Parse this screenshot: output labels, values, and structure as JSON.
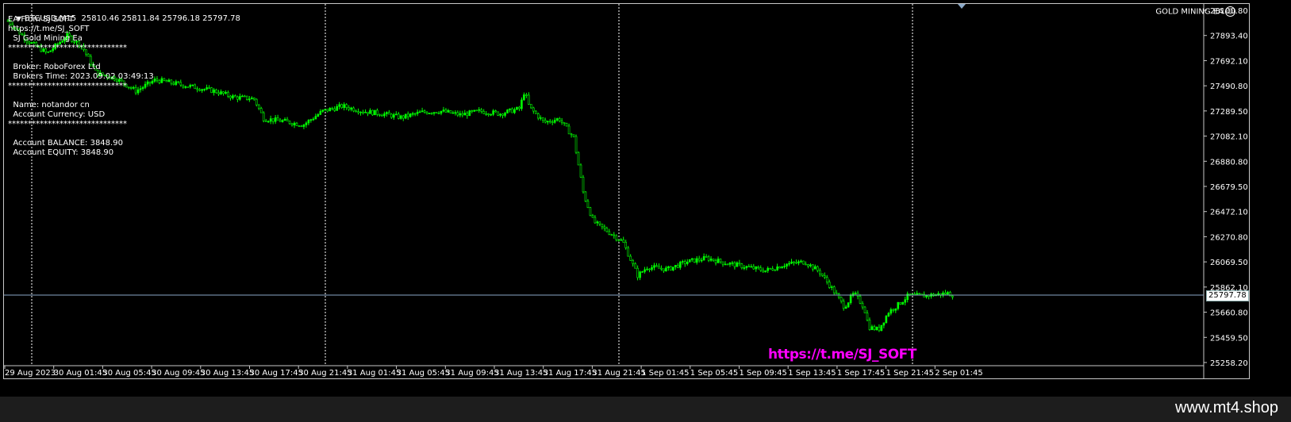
{
  "header": {
    "symbol": "BTCUSD,M15",
    "ohlc": "25810.46 25811.84 25796.18 25797.78"
  },
  "ea_label": "GOLD MINING EA",
  "info_lines": [
    "EA From SJ SOFT",
    "https://t.me/SJ_SOFT",
    "  SJ Gold Mining Ea",
    "******************************",
    "",
    "  Broker: RoboForex Ltd",
    "  Brokers Time: 2023.09.02 03:49:13",
    "******************************",
    "",
    "  Name: notandor cn",
    "  Account Currency: USD",
    "******************************",
    "",
    "  Account BALANCE: 3848.90",
    "  Account EQUITY: 3848.90"
  ],
  "watermark_link": "https://t.me/SJ_SOFT",
  "current_price": "25797.78",
  "footer_text": "www.mt4.shop",
  "colors": {
    "background": "#000000",
    "candle": "#00ff00",
    "grid_vertical": "#ffffff",
    "price_line": "#8aa8c8",
    "link": "#ff00ff"
  },
  "chart_data": {
    "type": "candlestick",
    "price_axis_ticks": [
      "28100.80",
      "27893.40",
      "27692.10",
      "27490.80",
      "27289.50",
      "27082.10",
      "26880.80",
      "26679.50",
      "26472.10",
      "26270.80",
      "26069.50",
      "25862.10",
      "25660.80",
      "25459.50",
      "25258.20"
    ],
    "time_axis_ticks": [
      "29 Aug 2023",
      "30 Aug 01:45",
      "30 Aug 05:45",
      "30 Aug 09:45",
      "30 Aug 13:45",
      "30 Aug 17:45",
      "30 Aug 21:45",
      "31 Aug 01:45",
      "31 Aug 05:45",
      "31 Aug 09:45",
      "31 Aug 13:45",
      "31 Aug 17:45",
      "31 Aug 21:45",
      "1 Sep 01:45",
      "1 Sep 05:45",
      "1 Sep 09:45",
      "1 Sep 13:45",
      "1 Sep 17:45",
      "1 Sep 21:45",
      "2 Sep 01:45"
    ],
    "ylim": [
      25258.2,
      28100.8
    ],
    "day_separators": [
      "30 Aug 00:00",
      "31 Aug 00:00",
      "1 Sep 00:00",
      "2 Sep 00:00"
    ],
    "price_path": [
      [
        0,
        27980
      ],
      [
        0.02,
        27820
      ],
      [
        0.04,
        27720
      ],
      [
        0.06,
        27860
      ],
      [
        0.075,
        27780
      ],
      [
        0.09,
        27560
      ],
      [
        0.11,
        27520
      ],
      [
        0.13,
        27420
      ],
      [
        0.15,
        27510
      ],
      [
        0.17,
        27480
      ],
      [
        0.19,
        27450
      ],
      [
        0.21,
        27420
      ],
      [
        0.23,
        27370
      ],
      [
        0.25,
        27360
      ],
      [
        0.26,
        27200
      ],
      [
        0.28,
        27180
      ],
      [
        0.3,
        27150
      ],
      [
        0.32,
        27260
      ],
      [
        0.34,
        27300
      ],
      [
        0.36,
        27260
      ],
      [
        0.38,
        27240
      ],
      [
        0.4,
        27210
      ],
      [
        0.42,
        27250
      ],
      [
        0.44,
        27260
      ],
      [
        0.46,
        27230
      ],
      [
        0.48,
        27260
      ],
      [
        0.5,
        27240
      ],
      [
        0.52,
        27280
      ],
      [
        0.525,
        27420
      ],
      [
        0.53,
        27290
      ],
      [
        0.545,
        27170
      ],
      [
        0.56,
        27200
      ],
      [
        0.575,
        27050
      ],
      [
        0.585,
        26600
      ],
      [
        0.595,
        26380
      ],
      [
        0.61,
        26300
      ],
      [
        0.625,
        26220
      ],
      [
        0.64,
        25950
      ],
      [
        0.65,
        26020
      ],
      [
        0.67,
        26000
      ],
      [
        0.69,
        26060
      ],
      [
        0.71,
        26090
      ],
      [
        0.73,
        26050
      ],
      [
        0.75,
        26020
      ],
      [
        0.77,
        25990
      ],
      [
        0.79,
        26040
      ],
      [
        0.81,
        26060
      ],
      [
        0.825,
        25980
      ],
      [
        0.84,
        25820
      ],
      [
        0.85,
        25700
      ],
      [
        0.86,
        25810
      ],
      [
        0.87,
        25700
      ],
      [
        0.875,
        25540
      ],
      [
        0.885,
        25520
      ],
      [
        0.895,
        25660
      ],
      [
        0.905,
        25720
      ],
      [
        0.915,
        25790
      ],
      [
        0.93,
        25790
      ],
      [
        0.945,
        25800
      ],
      [
        0.955,
        25810
      ],
      [
        0.96,
        25798
      ]
    ]
  }
}
